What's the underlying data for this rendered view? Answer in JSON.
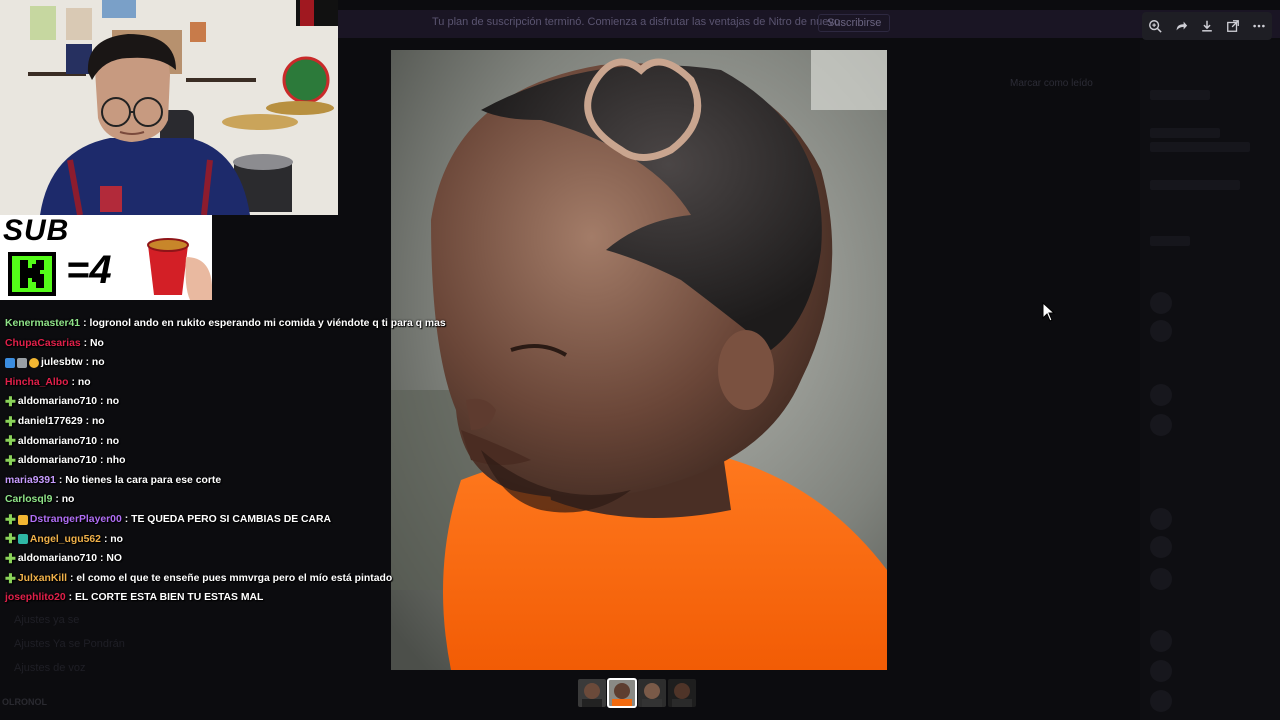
{
  "background": {
    "banner_text": "Tu plan de suscripción terminó. Comienza a disfrutar las ventajas de Nitro de nuevo.",
    "banner_button": "Suscribirse",
    "pinned_label": "Marcar como leído",
    "left_rows": [
      "Ajustes ya se",
      "Ajustes Ya se Pondrán",
      "Ajustes de voz"
    ],
    "bottom_label": "OLRONOL"
  },
  "viewer_toolbar": {
    "icons": [
      "zoom-icon",
      "forward-icon",
      "download-icon",
      "open-external-icon",
      "more-icon"
    ]
  },
  "sub_box": {
    "label": "SUB",
    "equation": "=4",
    "colors": {
      "kick_green": "#53fc18"
    }
  },
  "chat": {
    "messages": [
      {
        "badges": [],
        "user": "Kenermaster41",
        "color": "#8fe388",
        "text": ": logronol ando en rukito esperando mi comida y viéndote q ti para q mas"
      },
      {
        "badges": [],
        "user": "ChupaCasarias",
        "color": "#e0204a",
        "text": ": No"
      },
      {
        "badges": [
          "blue",
          "grey",
          "gold"
        ],
        "user": "julesbtw",
        "color": "#ffffff",
        "text": ": no"
      },
      {
        "badges": [],
        "user": "Hincha_Albo",
        "color": "#e0204a",
        "text": ": no"
      },
      {
        "badges": [
          "plus"
        ],
        "user": "aldomariano710",
        "color": "#ffffff",
        "text": ": no"
      },
      {
        "badges": [
          "plus"
        ],
        "user": "daniel177629",
        "color": "#ffffff",
        "text": ": no"
      },
      {
        "badges": [
          "plus"
        ],
        "user": "aldomariano710",
        "color": "#ffffff",
        "text": ": no"
      },
      {
        "badges": [
          "plus"
        ],
        "user": "aldomariano710",
        "color": "#ffffff",
        "text": ": nho"
      },
      {
        "badges": [],
        "user": "maria9391",
        "color": "#c79cff",
        "text": ": No tienes la cara para ese corte"
      },
      {
        "badges": [],
        "user": "Carlosql9",
        "color": "#8fe388",
        "text": ": no"
      },
      {
        "badges": [
          "plus",
          "gold"
        ],
        "user": "DstrangerPlayer00",
        "color": "#b06ef5",
        "text": ": TE QUEDA PERO SI CAMBIAS DE CARA"
      },
      {
        "badges": [
          "plus",
          "teal"
        ],
        "user": "Angel_ugu562",
        "color": "#f0b14a",
        "text": ": no"
      },
      {
        "badges": [
          "plus"
        ],
        "user": "aldomariano710",
        "color": "#ffffff",
        "text": ": NO"
      },
      {
        "badges": [
          "plus"
        ],
        "user": "JulxanKill",
        "color": "#f0b14a",
        "text": ": el como el que te enseñe pues mmvrga pero el mío está pintado"
      },
      {
        "badges": [],
        "user": "josephlito20",
        "color": "#e0204a",
        "text": ": EL CORTE ESTA BIEN TU ESTAS MAL"
      }
    ]
  },
  "thumbnails": {
    "count": 4,
    "active_index": 1
  }
}
